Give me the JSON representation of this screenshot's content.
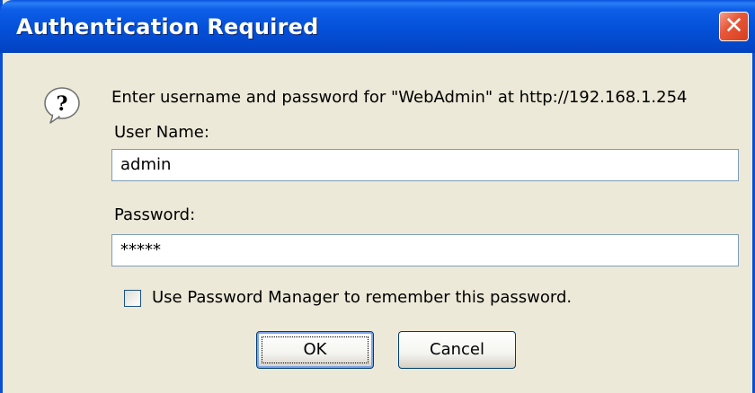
{
  "dialog": {
    "title": "Authentication Required",
    "close_glyph": "✕",
    "icon": "question-icon",
    "prompt": "Enter username and password for \"WebAdmin\" at http://192.168.1.254",
    "username_label": "User Name:",
    "username_value": "admin",
    "password_label": "Password:",
    "password_value": "*****",
    "remember_label": "Use Password Manager to remember this password.",
    "remember_checked": false,
    "ok_label": "OK",
    "cancel_label": "Cancel"
  },
  "colors": {
    "titlebar": "#0450d8",
    "window_bg": "#ece9d8",
    "close_button": "#d63e1e",
    "field_border": "#7f9db9"
  }
}
